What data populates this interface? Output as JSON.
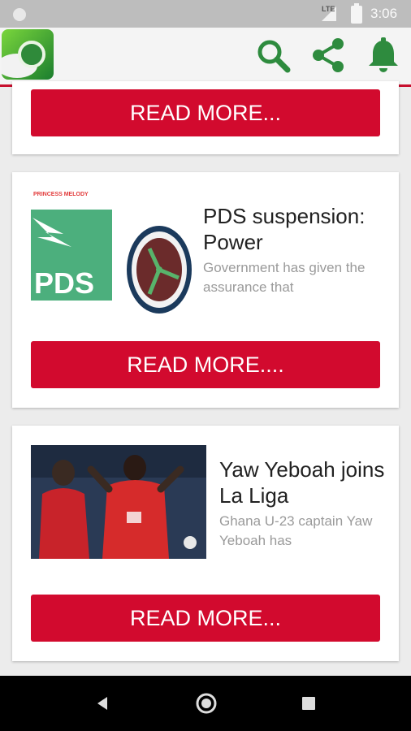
{
  "status": {
    "network": "LTE",
    "time": "3:06"
  },
  "appbar": {
    "logo_icon": "app-logo-icon",
    "search_icon": "search-icon",
    "share_icon": "share-icon",
    "bell_icon": "bell-icon",
    "accent": "#2e8b3e"
  },
  "articles": [
    {
      "title": "",
      "excerpt": "",
      "button": "READ MORE..."
    },
    {
      "title": "PDS suspension: Power",
      "excerpt": "Government has given the assurance that",
      "button": "READ MORE....",
      "thumb_caption": "PRINCESS MELODY",
      "thumb_logo_text": "PDS"
    },
    {
      "title": "Yaw Yeboah joins La Liga",
      "excerpt": "Ghana U-23 captain Yaw Yeboah has",
      "button": "READ MORE..."
    }
  ],
  "colors": {
    "brand_red": "#d20a2e",
    "pds_green": "#4caf7d"
  }
}
